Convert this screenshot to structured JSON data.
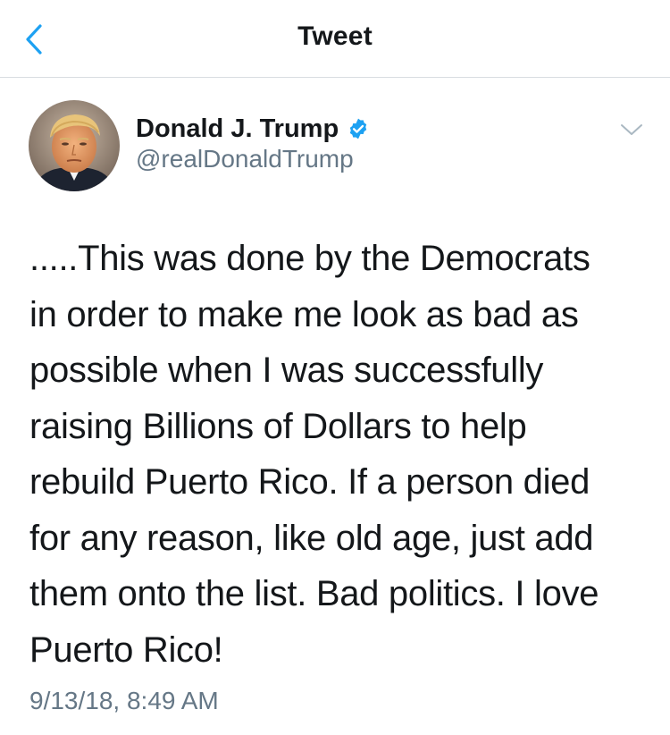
{
  "nav": {
    "title": "Tweet",
    "back_icon": "chevron-left-icon"
  },
  "colors": {
    "accent": "#1da1f2",
    "text_primary": "#14171a",
    "text_secondary": "#657786",
    "divider": "#d8dde1"
  },
  "tweet": {
    "author": {
      "name": "Donald J. Trump",
      "handle": "@realDonaldTrump",
      "verified_icon": "verified-badge-icon",
      "avatar_icon": "avatar-photo"
    },
    "options_icon": "chevron-down-icon",
    "text_lines": [
      ".....This was done by the Democrats",
      "in order to make me look as bad as",
      "possible when I was successfully",
      "raising Billions of Dollars to help",
      "rebuild Puerto Rico. If a person died",
      "for any reason, like old age, just add",
      "them onto the list. Bad politics. I love",
      "Puerto Rico!"
    ],
    "timestamp": "9/13/18, 8:49 AM"
  }
}
